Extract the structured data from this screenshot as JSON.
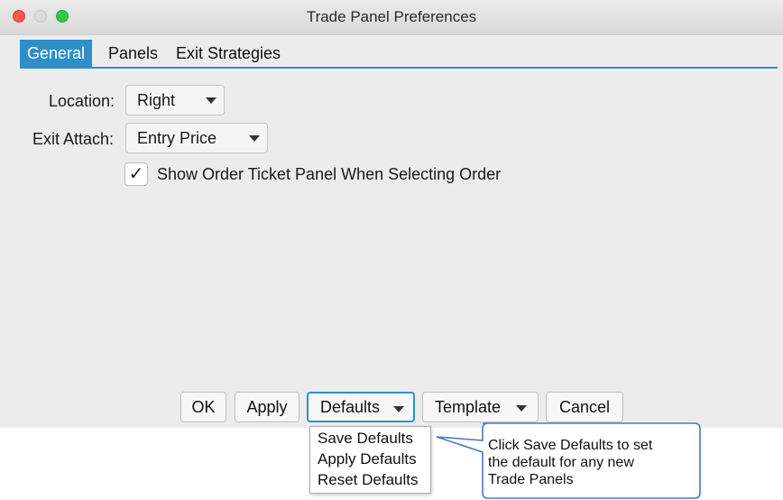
{
  "window": {
    "title": "Trade Panel Preferences"
  },
  "tabs": [
    {
      "label": "General",
      "active": true
    },
    {
      "label": "Panels",
      "active": false
    },
    {
      "label": "Exit Strategies",
      "active": false
    }
  ],
  "form": {
    "location_label": "Location:",
    "location_value": "Right",
    "exit_attach_label": "Exit Attach:",
    "exit_attach_value": "Entry Price",
    "show_ticket_label": "Show Order Ticket Panel When Selecting Order",
    "show_ticket_checked": true,
    "check_glyph": "✓"
  },
  "buttons": {
    "ok": "OK",
    "apply": "Apply",
    "defaults": "Defaults",
    "template": "Template",
    "cancel": "Cancel"
  },
  "defaults_menu": [
    "Save Defaults",
    "Apply Defaults",
    "Reset Defaults"
  ],
  "callout": {
    "line1": "Click Save Defaults to set",
    "line2": "the default for any new",
    "line3": "Trade Panels"
  },
  "colors": {
    "accent": "#2e8fc9",
    "close": "#fc5753",
    "maximize": "#33c748",
    "callout_border": "#4a78c8"
  }
}
